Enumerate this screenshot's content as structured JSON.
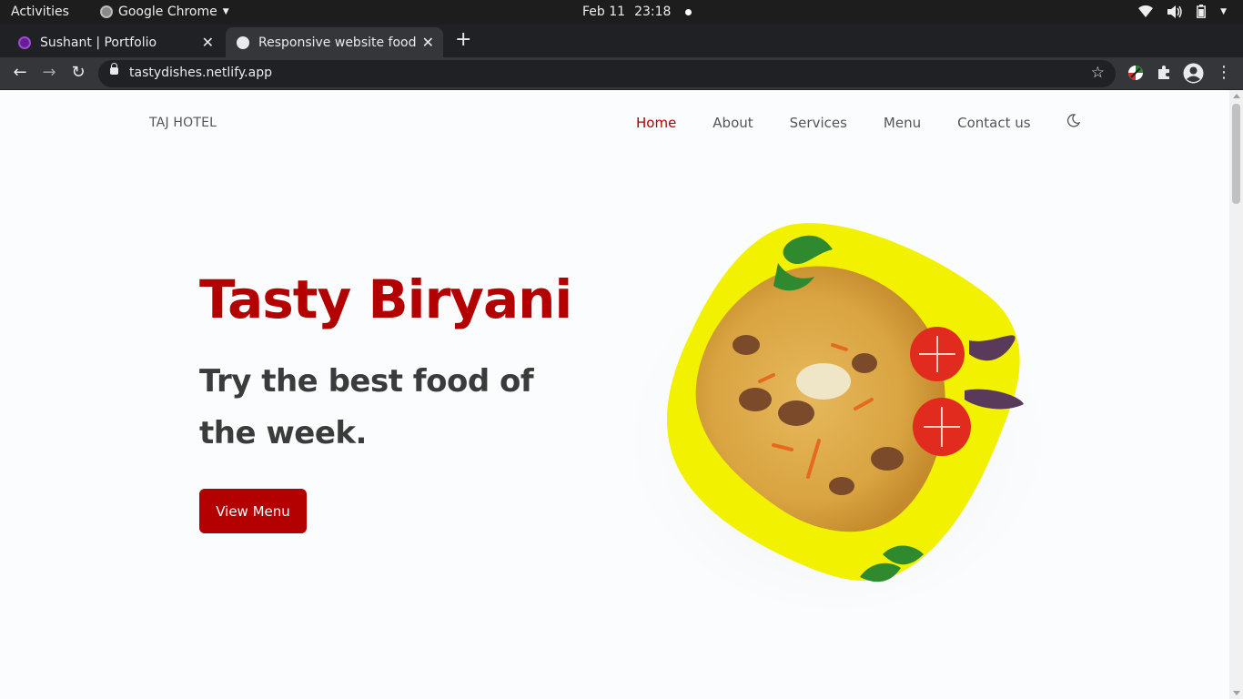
{
  "system_bar": {
    "activities": "Activities",
    "app_name": "Google Chrome",
    "date": "Feb 11",
    "time": "23:18"
  },
  "browser": {
    "tabs": [
      {
        "title": "Sushant | Portfolio",
        "active": false
      },
      {
        "title": "Responsive website food",
        "active": true
      }
    ],
    "url": "tastydishes.netlify.app"
  },
  "site": {
    "logo": "TAJ HOTEL",
    "nav": [
      {
        "label": "Home",
        "active": true
      },
      {
        "label": "About",
        "active": false
      },
      {
        "label": "Services",
        "active": false
      },
      {
        "label": "Menu",
        "active": false
      },
      {
        "label": "Contact us",
        "active": false
      }
    ],
    "hero": {
      "title": "Tasty Biryani",
      "subtitle": "Try the best food of the week.",
      "cta": "View Menu"
    }
  },
  "colors": {
    "accent": "#b30000",
    "text": "#3b3b3b",
    "plate": "#f2f200"
  }
}
